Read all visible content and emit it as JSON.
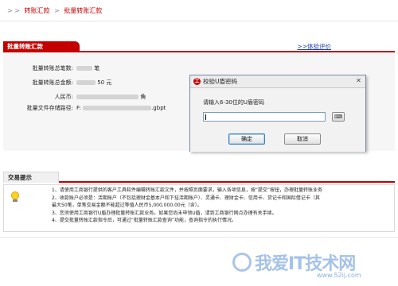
{
  "breadcrumb": {
    "items": [
      "转账汇款",
      "批量转账汇款"
    ]
  },
  "section": {
    "title": "批量转账汇款",
    "link": "体验评价"
  },
  "info": {
    "total_count_label": "批量转账总笔数:",
    "total_count_suffix": "笔",
    "total_amount_label": "批量转账总金额:",
    "total_amount_suffix": "50 元",
    "currency_label": "人民币:",
    "currency_suffix": "角",
    "file_path_label": "批量文件存储路径:",
    "file_path_prefix": "F:",
    "file_path_suffix": ".gbpt"
  },
  "dialog": {
    "title": "校验U盾密码",
    "prompt": "请输入6-30位的U盾密码",
    "password_value": "",
    "ok_label": "确定",
    "cancel_label": "取消",
    "close_glyph": "✕",
    "logo_icon": "icbc-logo-icon",
    "keyboard_icon": "keyboard-icon"
  },
  "tips": {
    "title": "交易提示",
    "items": [
      "1、请使用工商银行提供的客户工具软件编辑转账汇款文件，并按照页面要求，输入各项信息，按“提交”按钮，办理批量转账业务",
      "2、收款账户必须是：活期账户（不包括理财金基本户和下挂活期账户）、灵通卡、理财金卡、信用卡、贷记卡和国际借记卡（其",
      "最大50笔，单笔交易金额不能超过等值人民币5,000,000.00元（含）。",
      "3、您须使用工商银行U盾办理批量转账汇款业务。如果您尚未申领U盾，请到工商银行网点办理有关手续。",
      "4、提交批量转账汇款指令后，可通过“批量转账汇款查询”功能，查询指令的执行情况。"
    ]
  },
  "watermark": {
    "text": "我爱IT技术网",
    "url": "www.52ij.com"
  }
}
